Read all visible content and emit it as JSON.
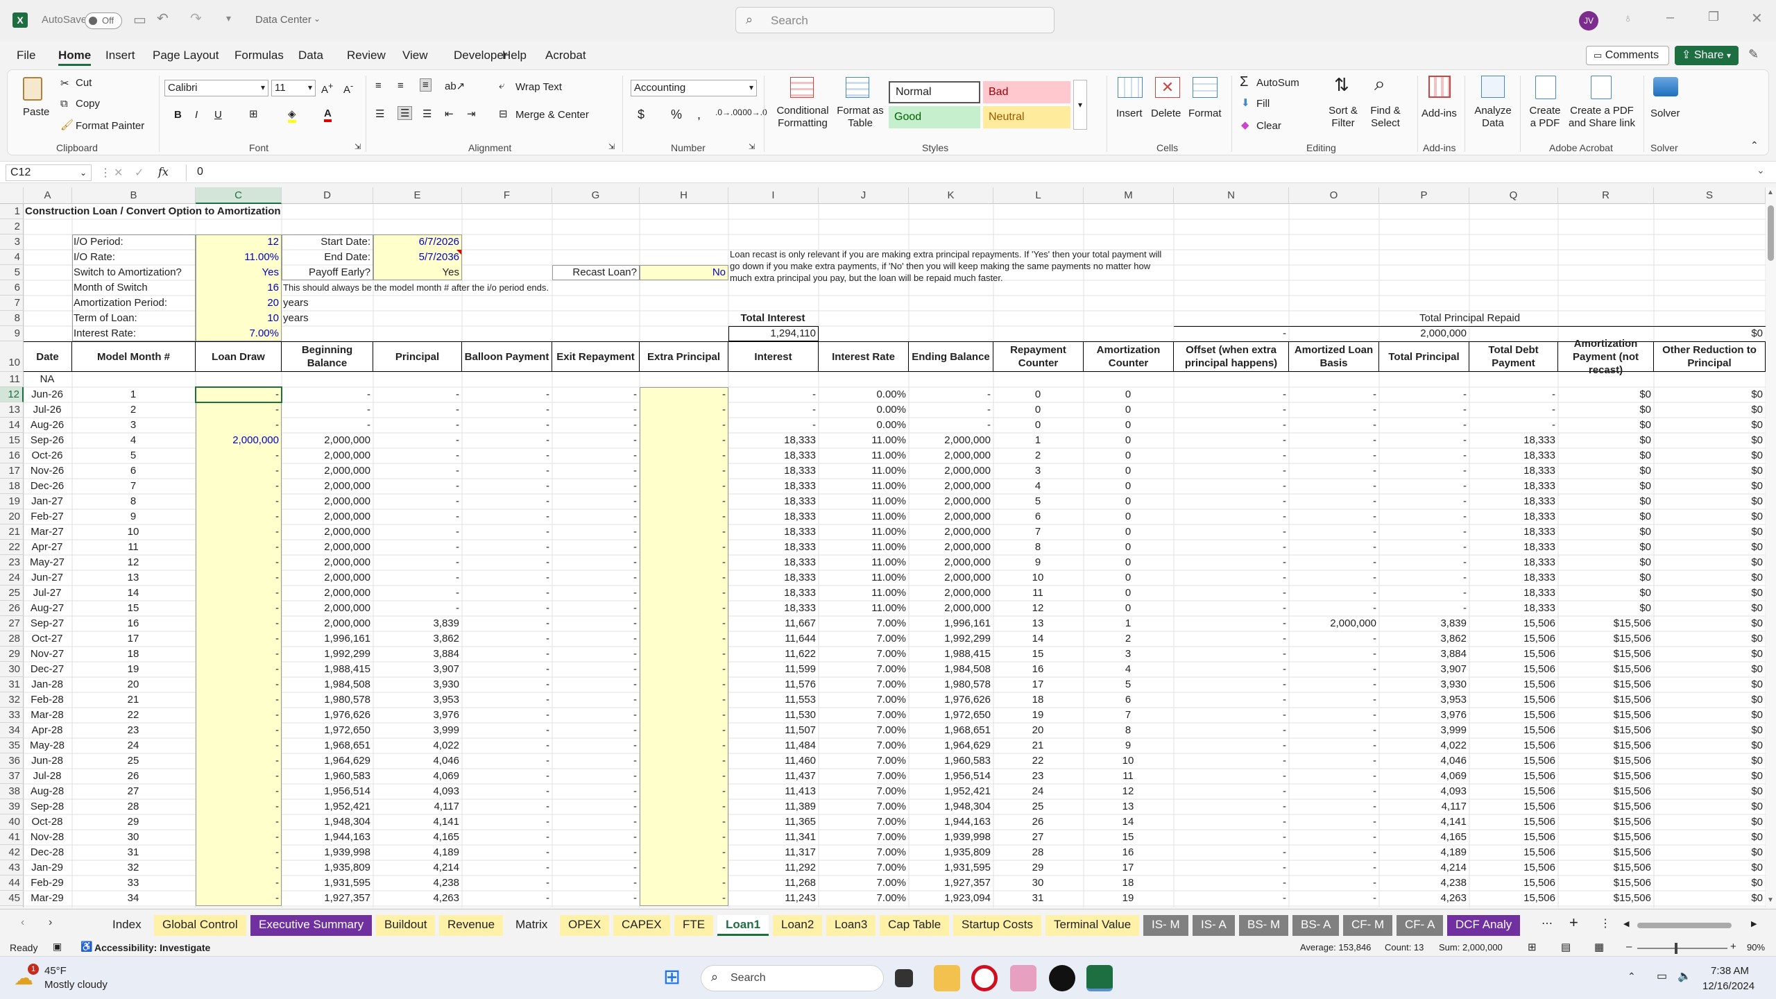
{
  "titlebar": {
    "autosave": "AutoSave",
    "autosave_state": "Off",
    "doc_title": "Data Center",
    "search_placeholder": "Search",
    "user_initials": "JV"
  },
  "menu": [
    "File",
    "Home",
    "Insert",
    "Page Layout",
    "Formulas",
    "Data",
    "Review",
    "View",
    "Developer",
    "Help",
    "Acrobat"
  ],
  "menu_active": "Home",
  "comments_label": "Comments",
  "share_label": "Share",
  "ribbon": {
    "clipboard": {
      "paste": "Paste",
      "cut": "Cut",
      "copy": "Copy",
      "format_painter": "Format Painter",
      "label": "Clipboard"
    },
    "font": {
      "name": "Calibri",
      "size": "11",
      "label": "Font"
    },
    "alignment": {
      "wrap": "Wrap Text",
      "merge": "Merge & Center",
      "label": "Alignment"
    },
    "number": {
      "format": "Accounting",
      "label": "Number"
    },
    "styles": {
      "conditional": "Conditional Formatting",
      "format_table": "Format as Table",
      "normal": "Normal",
      "bad": "Bad",
      "good": "Good",
      "neutral": "Neutral",
      "label": "Styles"
    },
    "cells": {
      "insert": "Insert",
      "delete": "Delete",
      "format": "Format",
      "label": "Cells"
    },
    "editing": {
      "autosum": "AutoSum",
      "fill": "Fill",
      "clear": "Clear",
      "sort": "Sort & Filter",
      "find": "Find & Select",
      "label": "Editing"
    },
    "addins": {
      "addins": "Add-ins",
      "analyze": "Analyze Data",
      "label": "Add-ins"
    },
    "acrobat": {
      "create_pdf": "Create a PDF",
      "create_share": "Create a PDF and Share link",
      "label": "Adobe Acrobat"
    },
    "solver": {
      "solver": "Solver",
      "label": "Solver"
    }
  },
  "formula_bar": {
    "name_box": "C12",
    "fx": "fx",
    "value": "0"
  },
  "columns": [
    "A",
    "B",
    "C",
    "D",
    "E",
    "F",
    "G",
    "H",
    "I",
    "J",
    "K",
    "L",
    "M",
    "N",
    "O",
    "P",
    "Q",
    "R",
    "S"
  ],
  "sheet": {
    "title": "Construction Loan / Convert Option to Amortization",
    "inputs": [
      {
        "label": "I/O Period:",
        "value": "12"
      },
      {
        "label": "I/O Rate:",
        "value": "11.00%"
      },
      {
        "label": "Switch to Amortization?",
        "value": "Yes"
      },
      {
        "label": "Month of Switch",
        "value": "16",
        "note": "This should always be the model month # after the i/o period ends."
      },
      {
        "label": "Amortization Period:",
        "value": "20",
        "unit": "years"
      },
      {
        "label": "Term of Loan:",
        "value": "10",
        "unit": "years"
      },
      {
        "label": "Interest Rate:",
        "value": "7.00%"
      }
    ],
    "dates": [
      {
        "label": "Start Date:",
        "value": "6/7/2026"
      },
      {
        "label": "End Date:",
        "value": "5/7/2036"
      },
      {
        "label": "Payoff Early?",
        "value": "Yes"
      }
    ],
    "recast": {
      "label": "Recast Loan?",
      "value": "No",
      "note": "Loan recast is only relevant if you are making extra principal repayments. If 'Yes' then your total payment will go down if you make extra payments, if 'No' then you will keep making the same payments no matter how much extra principal you pay, but the loan will be repaid much faster."
    },
    "total_interest_label": "Total Interest",
    "total_interest": "1,294,110",
    "total_principal_label": "Total Principal Repaid",
    "offset_total": "-",
    "principal_total": "2,000,000",
    "other_total": "$0",
    "headers": [
      "Date",
      "Model Month #",
      "Loan Draw",
      "Beginning Balance",
      "Principal",
      "Balloon Payment",
      "Exit Repayment",
      "Extra Principal",
      "Interest",
      "Interest Rate",
      "Ending Balance",
      "Repayment Counter",
      "Amortization Counter",
      "Offset (when extra principal happens)",
      "Amortized Loan Basis",
      "Total Principal",
      "Total Debt Payment",
      "Amortization Payment (not recast)",
      "Other Reduction to Principal"
    ],
    "na_label": "NA",
    "rows": [
      [
        "Jun-26",
        "1",
        "-",
        "-",
        "-",
        "-",
        "-",
        "-",
        "-",
        "0.00%",
        "-",
        "0",
        "0",
        "-",
        "-",
        "-",
        "-",
        "$0",
        "$0"
      ],
      [
        "Jul-26",
        "2",
        "-",
        "-",
        "-",
        "-",
        "-",
        "-",
        "-",
        "0.00%",
        "-",
        "0",
        "0",
        "-",
        "-",
        "-",
        "-",
        "$0",
        "$0"
      ],
      [
        "Aug-26",
        "3",
        "-",
        "-",
        "-",
        "-",
        "-",
        "-",
        "-",
        "0.00%",
        "-",
        "0",
        "0",
        "-",
        "-",
        "-",
        "-",
        "$0",
        "$0"
      ],
      [
        "Sep-26",
        "4",
        "2,000,000",
        "2,000,000",
        "-",
        "-",
        "-",
        "-",
        "18,333",
        "11.00%",
        "2,000,000",
        "1",
        "0",
        "-",
        "-",
        "-",
        "18,333",
        "$0",
        "$0"
      ],
      [
        "Oct-26",
        "5",
        "-",
        "2,000,000",
        "-",
        "-",
        "-",
        "-",
        "18,333",
        "11.00%",
        "2,000,000",
        "2",
        "0",
        "-",
        "-",
        "-",
        "18,333",
        "$0",
        "$0"
      ],
      [
        "Nov-26",
        "6",
        "-",
        "2,000,000",
        "-",
        "-",
        "-",
        "-",
        "18,333",
        "11.00%",
        "2,000,000",
        "3",
        "0",
        "-",
        "-",
        "-",
        "18,333",
        "$0",
        "$0"
      ],
      [
        "Dec-26",
        "7",
        "-",
        "2,000,000",
        "-",
        "-",
        "-",
        "-",
        "18,333",
        "11.00%",
        "2,000,000",
        "4",
        "0",
        "-",
        "-",
        "-",
        "18,333",
        "$0",
        "$0"
      ],
      [
        "Jan-27",
        "8",
        "-",
        "2,000,000",
        "-",
        "-",
        "-",
        "-",
        "18,333",
        "11.00%",
        "2,000,000",
        "5",
        "0",
        "-",
        "-",
        "-",
        "18,333",
        "$0",
        "$0"
      ],
      [
        "Feb-27",
        "9",
        "-",
        "2,000,000",
        "-",
        "-",
        "-",
        "-",
        "18,333",
        "11.00%",
        "2,000,000",
        "6",
        "0",
        "-",
        "-",
        "-",
        "18,333",
        "$0",
        "$0"
      ],
      [
        "Mar-27",
        "10",
        "-",
        "2,000,000",
        "-",
        "-",
        "-",
        "-",
        "18,333",
        "11.00%",
        "2,000,000",
        "7",
        "0",
        "-",
        "-",
        "-",
        "18,333",
        "$0",
        "$0"
      ],
      [
        "Apr-27",
        "11",
        "-",
        "2,000,000",
        "-",
        "-",
        "-",
        "-",
        "18,333",
        "11.00%",
        "2,000,000",
        "8",
        "0",
        "-",
        "-",
        "-",
        "18,333",
        "$0",
        "$0"
      ],
      [
        "May-27",
        "12",
        "-",
        "2,000,000",
        "-",
        "-",
        "-",
        "-",
        "18,333",
        "11.00%",
        "2,000,000",
        "9",
        "0",
        "-",
        "-",
        "-",
        "18,333",
        "$0",
        "$0"
      ],
      [
        "Jun-27",
        "13",
        "-",
        "2,000,000",
        "-",
        "-",
        "-",
        "-",
        "18,333",
        "11.00%",
        "2,000,000",
        "10",
        "0",
        "-",
        "-",
        "-",
        "18,333",
        "$0",
        "$0"
      ],
      [
        "Jul-27",
        "14",
        "-",
        "2,000,000",
        "-",
        "-",
        "-",
        "-",
        "18,333",
        "11.00%",
        "2,000,000",
        "11",
        "0",
        "-",
        "-",
        "-",
        "18,333",
        "$0",
        "$0"
      ],
      [
        "Aug-27",
        "15",
        "-",
        "2,000,000",
        "-",
        "-",
        "-",
        "-",
        "18,333",
        "11.00%",
        "2,000,000",
        "12",
        "0",
        "-",
        "-",
        "-",
        "18,333",
        "$0",
        "$0"
      ],
      [
        "Sep-27",
        "16",
        "-",
        "2,000,000",
        "3,839",
        "-",
        "-",
        "-",
        "11,667",
        "7.00%",
        "1,996,161",
        "13",
        "1",
        "-",
        "2,000,000",
        "3,839",
        "15,506",
        "$15,506",
        "$0"
      ],
      [
        "Oct-27",
        "17",
        "-",
        "1,996,161",
        "3,862",
        "-",
        "-",
        "-",
        "11,644",
        "7.00%",
        "1,992,299",
        "14",
        "2",
        "-",
        "-",
        "3,862",
        "15,506",
        "$15,506",
        "$0"
      ],
      [
        "Nov-27",
        "18",
        "-",
        "1,992,299",
        "3,884",
        "-",
        "-",
        "-",
        "11,622",
        "7.00%",
        "1,988,415",
        "15",
        "3",
        "-",
        "-",
        "3,884",
        "15,506",
        "$15,506",
        "$0"
      ],
      [
        "Dec-27",
        "19",
        "-",
        "1,988,415",
        "3,907",
        "-",
        "-",
        "-",
        "11,599",
        "7.00%",
        "1,984,508",
        "16",
        "4",
        "-",
        "-",
        "3,907",
        "15,506",
        "$15,506",
        "$0"
      ],
      [
        "Jan-28",
        "20",
        "-",
        "1,984,508",
        "3,930",
        "-",
        "-",
        "-",
        "11,576",
        "7.00%",
        "1,980,578",
        "17",
        "5",
        "-",
        "-",
        "3,930",
        "15,506",
        "$15,506",
        "$0"
      ],
      [
        "Feb-28",
        "21",
        "-",
        "1,980,578",
        "3,953",
        "-",
        "-",
        "-",
        "11,553",
        "7.00%",
        "1,976,626",
        "18",
        "6",
        "-",
        "-",
        "3,953",
        "15,506",
        "$15,506",
        "$0"
      ],
      [
        "Mar-28",
        "22",
        "-",
        "1,976,626",
        "3,976",
        "-",
        "-",
        "-",
        "11,530",
        "7.00%",
        "1,972,650",
        "19",
        "7",
        "-",
        "-",
        "3,976",
        "15,506",
        "$15,506",
        "$0"
      ],
      [
        "Apr-28",
        "23",
        "-",
        "1,972,650",
        "3,999",
        "-",
        "-",
        "-",
        "11,507",
        "7.00%",
        "1,968,651",
        "20",
        "8",
        "-",
        "-",
        "3,999",
        "15,506",
        "$15,506",
        "$0"
      ],
      [
        "May-28",
        "24",
        "-",
        "1,968,651",
        "4,022",
        "-",
        "-",
        "-",
        "11,484",
        "7.00%",
        "1,964,629",
        "21",
        "9",
        "-",
        "-",
        "4,022",
        "15,506",
        "$15,506",
        "$0"
      ],
      [
        "Jun-28",
        "25",
        "-",
        "1,964,629",
        "4,046",
        "-",
        "-",
        "-",
        "11,460",
        "7.00%",
        "1,960,583",
        "22",
        "10",
        "-",
        "-",
        "4,046",
        "15,506",
        "$15,506",
        "$0"
      ],
      [
        "Jul-28",
        "26",
        "-",
        "1,960,583",
        "4,069",
        "-",
        "-",
        "-",
        "11,437",
        "7.00%",
        "1,956,514",
        "23",
        "11",
        "-",
        "-",
        "4,069",
        "15,506",
        "$15,506",
        "$0"
      ],
      [
        "Aug-28",
        "27",
        "-",
        "1,956,514",
        "4,093",
        "-",
        "-",
        "-",
        "11,413",
        "7.00%",
        "1,952,421",
        "24",
        "12",
        "-",
        "-",
        "4,093",
        "15,506",
        "$15,506",
        "$0"
      ],
      [
        "Sep-28",
        "28",
        "-",
        "1,952,421",
        "4,117",
        "-",
        "-",
        "-",
        "11,389",
        "7.00%",
        "1,948,304",
        "25",
        "13",
        "-",
        "-",
        "4,117",
        "15,506",
        "$15,506",
        "$0"
      ],
      [
        "Oct-28",
        "29",
        "-",
        "1,948,304",
        "4,141",
        "-",
        "-",
        "-",
        "11,365",
        "7.00%",
        "1,944,163",
        "26",
        "14",
        "-",
        "-",
        "4,141",
        "15,506",
        "$15,506",
        "$0"
      ],
      [
        "Nov-28",
        "30",
        "-",
        "1,944,163",
        "4,165",
        "-",
        "-",
        "-",
        "11,341",
        "7.00%",
        "1,939,998",
        "27",
        "15",
        "-",
        "-",
        "4,165",
        "15,506",
        "$15,506",
        "$0"
      ],
      [
        "Dec-28",
        "31",
        "-",
        "1,939,998",
        "4,189",
        "-",
        "-",
        "-",
        "11,317",
        "7.00%",
        "1,935,809",
        "28",
        "16",
        "-",
        "-",
        "4,189",
        "15,506",
        "$15,506",
        "$0"
      ],
      [
        "Jan-29",
        "32",
        "-",
        "1,935,809",
        "4,214",
        "-",
        "-",
        "-",
        "11,292",
        "7.00%",
        "1,931,595",
        "29",
        "17",
        "-",
        "-",
        "4,214",
        "15,506",
        "$15,506",
        "$0"
      ],
      [
        "Feb-29",
        "33",
        "-",
        "1,931,595",
        "4,238",
        "-",
        "-",
        "-",
        "11,268",
        "7.00%",
        "1,927,357",
        "30",
        "18",
        "-",
        "-",
        "4,238",
        "15,506",
        "$15,506",
        "$0"
      ],
      [
        "Mar-29",
        "34",
        "-",
        "1,927,357",
        "4,263",
        "-",
        "-",
        "-",
        "11,243",
        "7.00%",
        "1,923,094",
        "31",
        "19",
        "-",
        "-",
        "4,263",
        "15,506",
        "$15,506",
        "$0"
      ]
    ]
  },
  "tabs": [
    {
      "name": "Index",
      "bg": "#f3f3f3",
      "fg": "#222"
    },
    {
      "name": "Global Control",
      "bg": "#fff2a8",
      "fg": "#222"
    },
    {
      "name": "Executive Summary",
      "bg": "#7030a0",
      "fg": "#fff"
    },
    {
      "name": "Buildout",
      "bg": "#fff2a8",
      "fg": "#222"
    },
    {
      "name": "Revenue",
      "bg": "#fff2a8",
      "fg": "#222"
    },
    {
      "name": "Matrix",
      "bg": "#f3f3f3",
      "fg": "#222"
    },
    {
      "name": "OPEX",
      "bg": "#fff2a8",
      "fg": "#222"
    },
    {
      "name": "CAPEX",
      "bg": "#fff2a8",
      "fg": "#222"
    },
    {
      "name": "FTE",
      "bg": "#fff2a8",
      "fg": "#222"
    },
    {
      "name": "Loan1",
      "bg": "#ffffff",
      "fg": "#1d6f42"
    },
    {
      "name": "Loan2",
      "bg": "#fff2a8",
      "fg": "#222"
    },
    {
      "name": "Loan3",
      "bg": "#fff2a8",
      "fg": "#222"
    },
    {
      "name": "Cap Table",
      "bg": "#fff2a8",
      "fg": "#222"
    },
    {
      "name": "Startup Costs",
      "bg": "#fff2a8",
      "fg": "#222"
    },
    {
      "name": "Terminal Value",
      "bg": "#fff2a8",
      "fg": "#222"
    },
    {
      "name": "IS- M",
      "bg": "#808080",
      "fg": "#fff"
    },
    {
      "name": "IS- A",
      "bg": "#808080",
      "fg": "#fff"
    },
    {
      "name": "BS- M",
      "bg": "#808080",
      "fg": "#fff"
    },
    {
      "name": "BS- A",
      "bg": "#808080",
      "fg": "#fff"
    },
    {
      "name": "CF- M",
      "bg": "#808080",
      "fg": "#fff"
    },
    {
      "name": "CF- A",
      "bg": "#808080",
      "fg": "#fff"
    },
    {
      "name": "DCF Analy",
      "bg": "#7030a0",
      "fg": "#fff"
    }
  ],
  "status": {
    "ready": "Ready",
    "accessibility": "Accessibility: Investigate",
    "average": "Average: 153,846",
    "count": "Count: 13",
    "sum": "Sum: 2,000,000",
    "zoom": "90%"
  },
  "taskbar": {
    "temp": "45°F",
    "weather": "Mostly cloudy",
    "badge": "1",
    "search": "Search",
    "time": "7:38 AM",
    "date": "12/16/2024"
  }
}
